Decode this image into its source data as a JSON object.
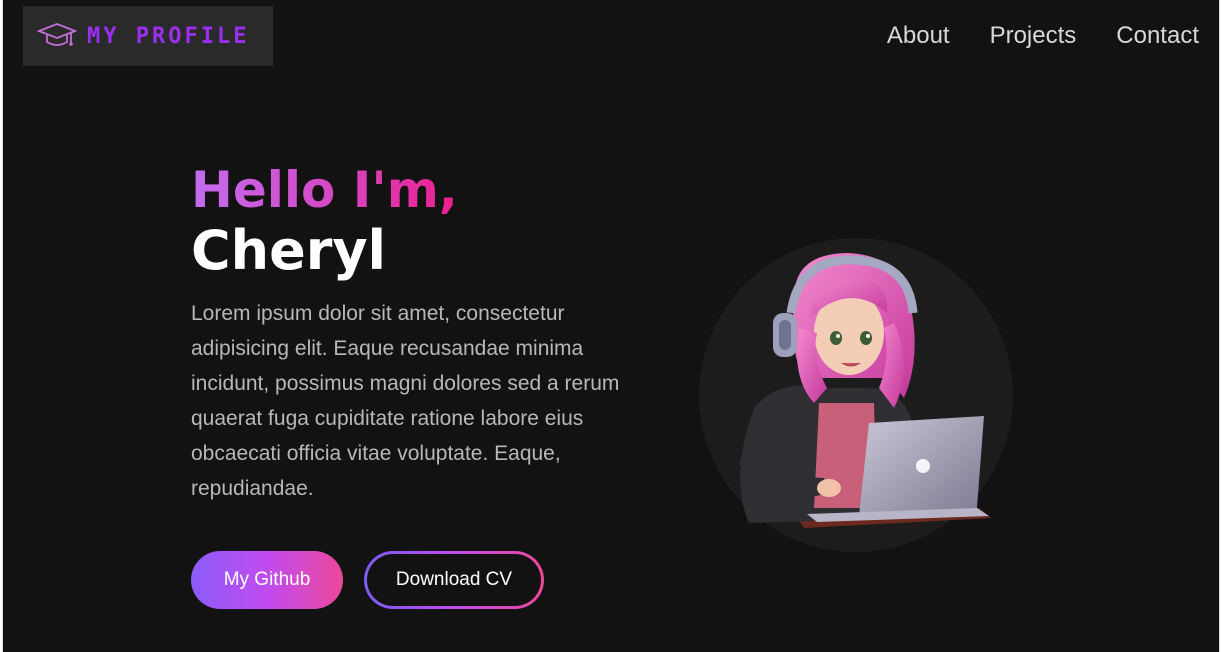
{
  "nav": {
    "logo_text": "MY PROFILE",
    "links": [
      "About",
      "Projects",
      "Contact"
    ]
  },
  "hero": {
    "greeting": "Hello I'm,",
    "name": "Cheryl",
    "description": "Lorem ipsum dolor sit amet, consectetur adipisicing elit. Eaque recusandae minima incidunt, possimus magni dolores sed a rerum quaerat fuga cupiditate ratione labore eius obcaecati officia vitae voluptate. Eaque, repudiandae.",
    "github_button": "My Github",
    "cv_button": "Download CV"
  },
  "icons": {
    "logo": "graduation-cap-icon",
    "avatar": "avatar-girl-laptop-illustration"
  },
  "colors": {
    "background": "#121213",
    "logo_box": "#2a2a2b",
    "logo_text": "#9b2ff1",
    "gradient_start": "#8b5cf6",
    "gradient_end": "#ec4899",
    "nav_text": "#d8d8d8",
    "body_text": "#b8b8b8"
  }
}
